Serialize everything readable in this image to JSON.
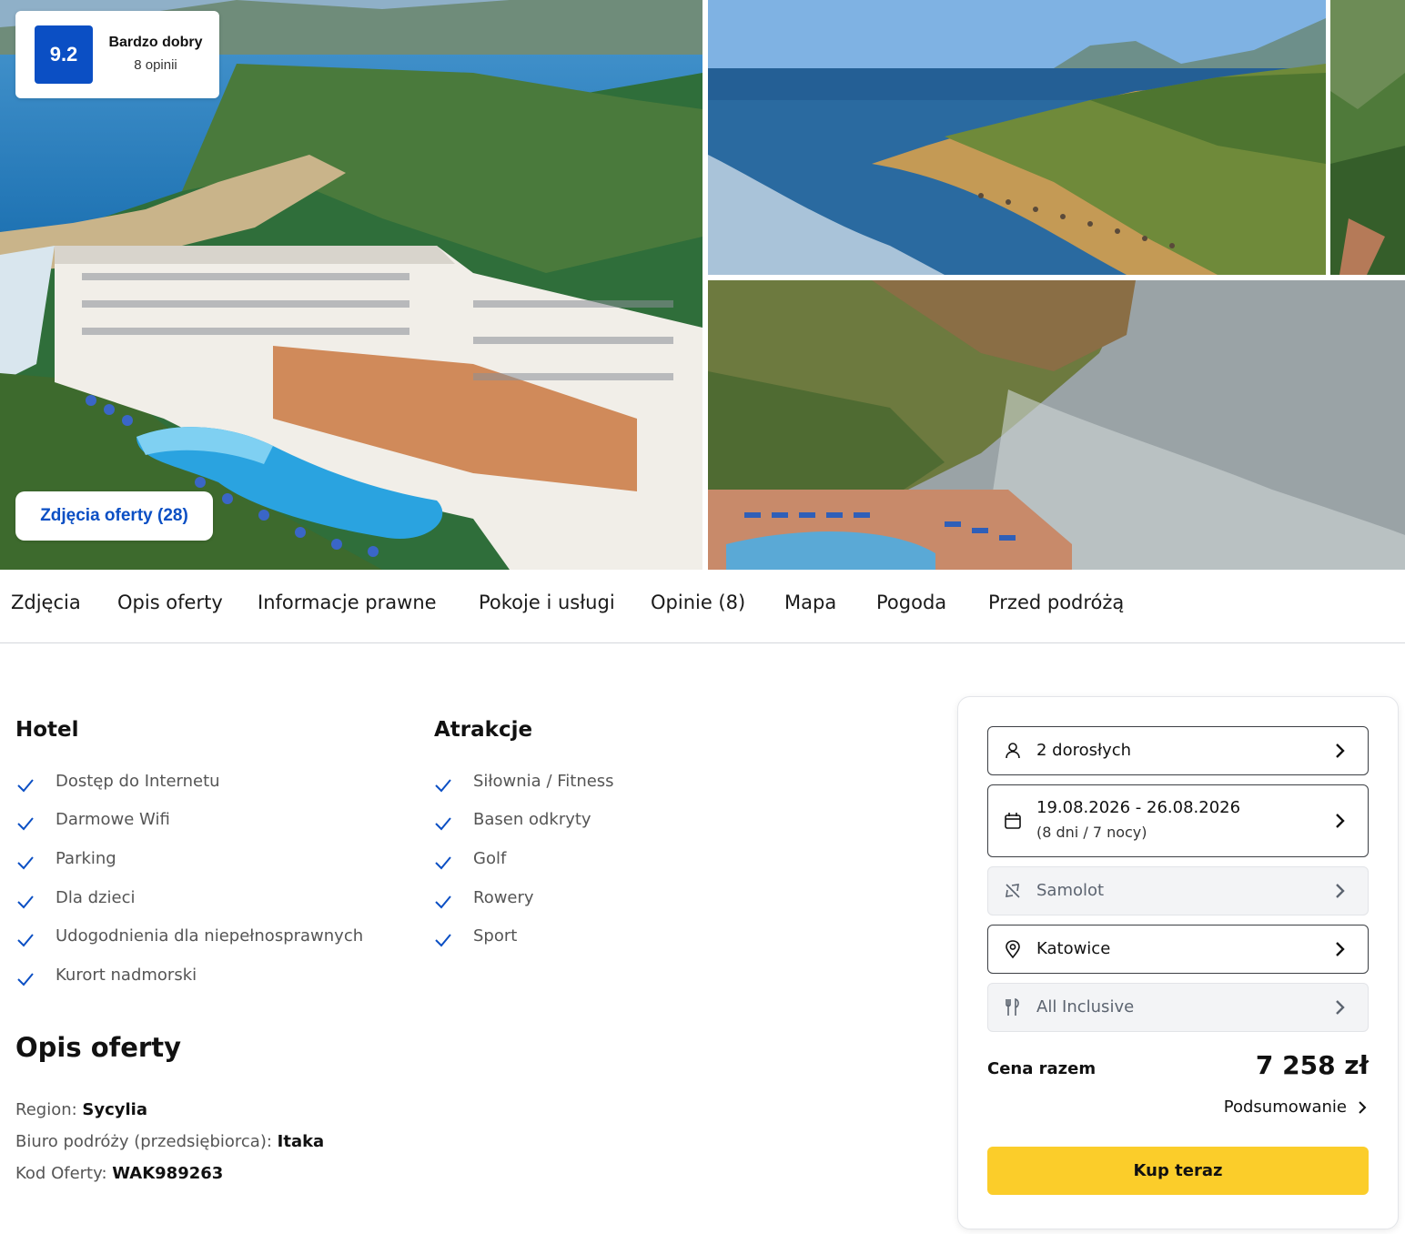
{
  "gallery": {
    "rating": {
      "score": "9.2",
      "label": "Bardzo dobry",
      "count": "8 opinii"
    },
    "photos_button": "Zdjęcia oferty (28)"
  },
  "tabs": [
    "Zdjęcia",
    "Opis oferty",
    "Informacje prawne",
    "Pokoje i usługi",
    "Opinie (8)",
    "Mapa",
    "Pogoda",
    "Przed podróżą"
  ],
  "amenities": {
    "hotel": {
      "title": "Hotel",
      "items": [
        "Dostęp do Internetu",
        "Darmowe Wifi",
        "Parking",
        "Dla dzieci",
        "Udogodnienia dla niepełnosprawnych",
        "Kurort nadmorski"
      ]
    },
    "attractions": {
      "title": "Atrakcje",
      "items": [
        "Siłownia / Fitness",
        "Basen odkryty",
        "Golf",
        "Rowery",
        "Sport"
      ]
    }
  },
  "offer": {
    "title": "Opis oferty",
    "region_label": "Region: ",
    "region_value": "Sycylia",
    "operator_label": "Biuro podróży (przedsiębiorca): ",
    "operator_value": "Itaka",
    "code_label": "Kod Oferty: ",
    "code_value": "WAK989263"
  },
  "booking": {
    "travelers": "2 dorosłych",
    "dates": "19.08.2026 - 26.08.2026",
    "duration": "(8 dni / 7 nocy)",
    "transport": "Samolot",
    "departure": "Katowice",
    "board": "All Inclusive",
    "total_label": "Cena razem",
    "total_price": "7 258 zł",
    "summary_link": "Podsumowanie",
    "buy_button": "Kup teraz"
  },
  "colors": {
    "brand_blue": "#0b4fc4",
    "buy_yellow": "#fbcd2a",
    "check_blue": "#0b4fc4"
  }
}
